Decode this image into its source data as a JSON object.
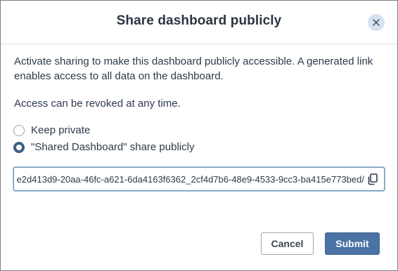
{
  "dialog": {
    "title": "Share dashboard publicly",
    "close_icon": "close-icon",
    "description": "Activate sharing to make this dashboard publicly accessible. A generated link enables access to all data on the dashboard.",
    "revoke_note": "Access can be revoked at any time.",
    "options": [
      {
        "label": "Keep private",
        "selected": false
      },
      {
        "label": "\"Shared Dashboard\" share publicly",
        "selected": true
      }
    ],
    "link": {
      "value": "/e2d413d9-20aa-46fc-a621-6da4163f6362_2cf4d7b6-48e9-4533-9cc3-ba415e773bed",
      "copy_icon": "copy-icon"
    },
    "buttons": {
      "cancel": "Cancel",
      "submit": "Submit"
    },
    "colors": {
      "accent": "#4a72a3",
      "radio_selected": "#3d5f86",
      "close_bg": "#d6e2ef"
    }
  }
}
